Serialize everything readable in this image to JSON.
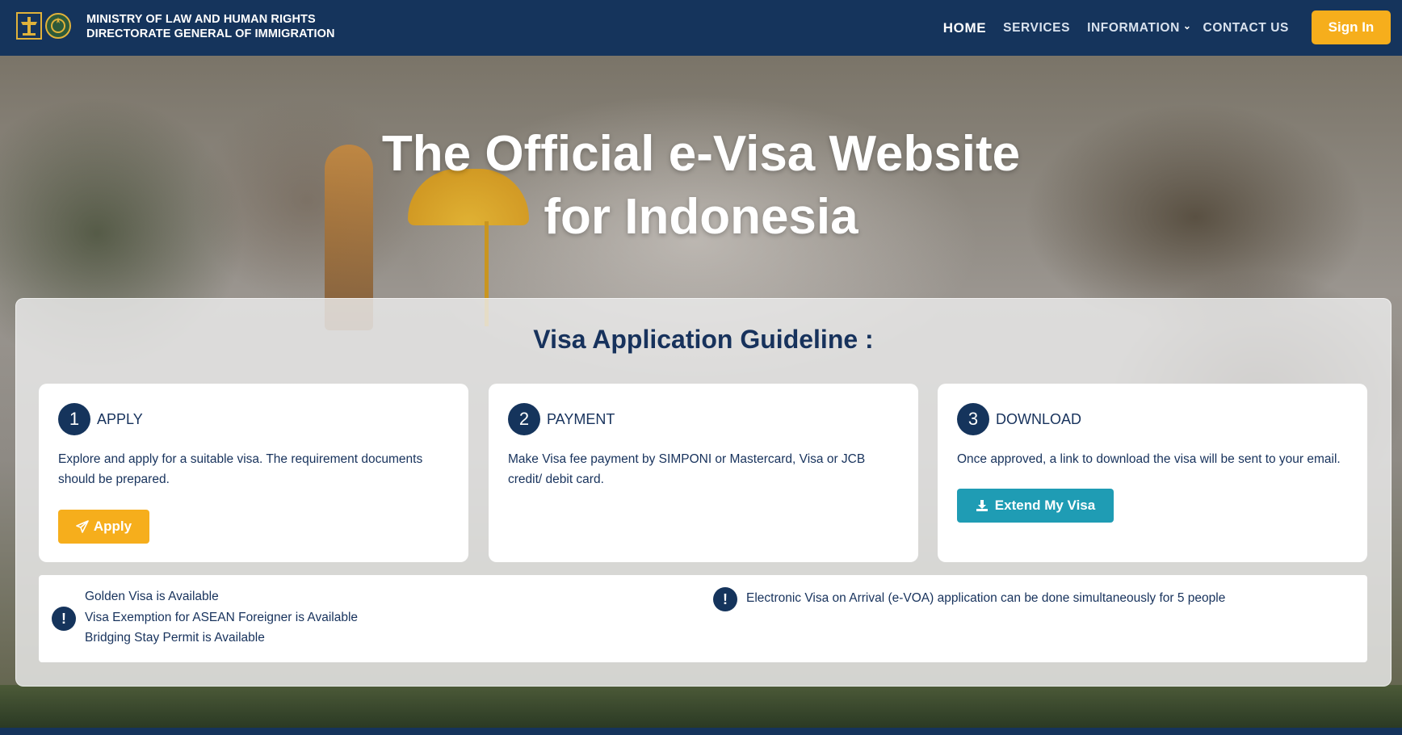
{
  "header": {
    "brand_line1": "MINISTRY OF  LAW  AND HUMAN RIGHTS",
    "brand_line2": "DIRECTORATE GENERAL OF IMMIGRATION",
    "nav": [
      {
        "label": "HOME",
        "active": true
      },
      {
        "label": "SERVICES"
      },
      {
        "label": "INFORMATION",
        "dropdown": true
      },
      {
        "label": "CONTACT US"
      }
    ],
    "signin_label": "Sign In",
    "accent": "#f6ae1c",
    "bg": "#15345c"
  },
  "hero": {
    "title_line1": "The Official e-Visa Website",
    "title_line2": "for Indonesia"
  },
  "guideline": {
    "title": "Visa Application Guideline :",
    "steps": [
      {
        "number": "1",
        "title": "APPLY",
        "description": "Explore and apply for a suitable visa. The requirement documents should be prepared.",
        "button": "Apply",
        "button_icon": "paper-plane-icon"
      },
      {
        "number": "2",
        "title": "PAYMENT",
        "description": "Make Visa fee payment by SIMPONI or Mastercard, Visa or JCB credit/ debit card."
      },
      {
        "number": "3",
        "title": "DOWNLOAD",
        "description": "Once approved, a link to download the visa will be sent to your email.",
        "button": "Extend My Visa",
        "button_icon": "download-icon"
      }
    ]
  },
  "info": {
    "left": [
      "Golden Visa is Available",
      "Visa Exemption for ASEAN Foreigner is Available",
      "Bridging Stay Permit is Available"
    ],
    "right": "Electronic Visa on Arrival (e-VOA) application can be done simultaneously for 5 people",
    "icon_glyph": "!"
  }
}
